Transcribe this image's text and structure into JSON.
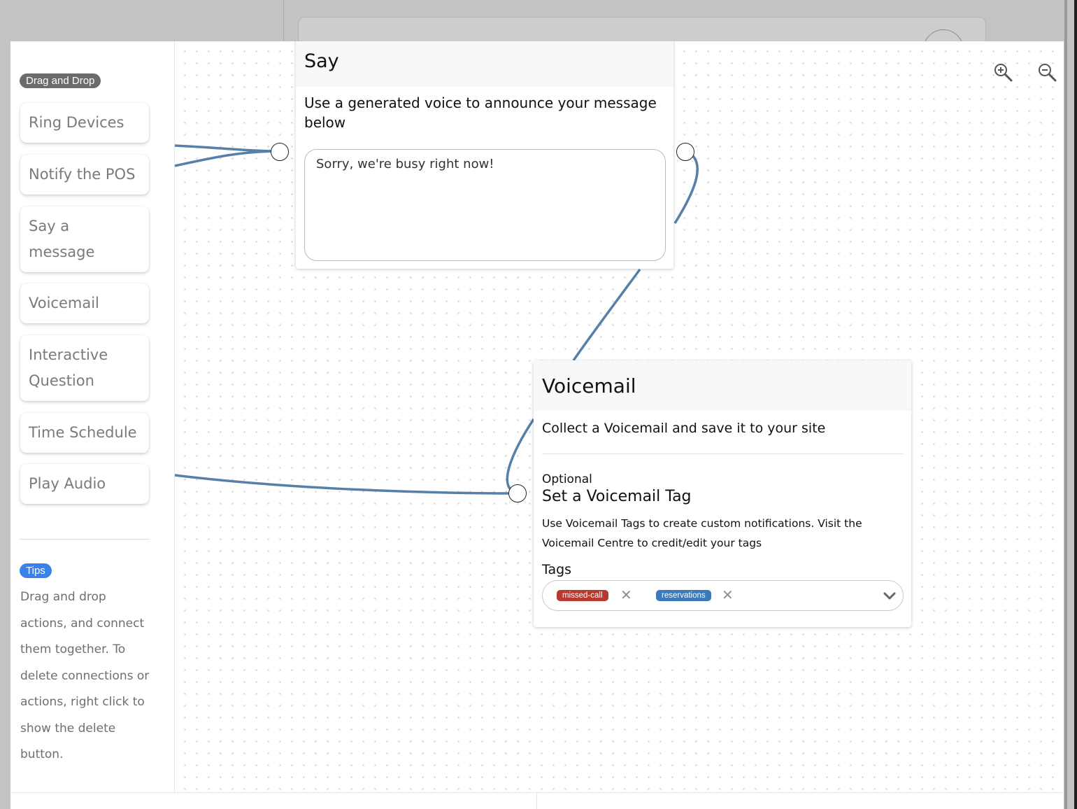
{
  "sidebar": {
    "section_label": "Drag and Drop",
    "tools": [
      {
        "label": "Ring Devices"
      },
      {
        "label": "Notify the POS"
      },
      {
        "label": "Say a message"
      },
      {
        "label": "Voicemail"
      },
      {
        "label": "Interactive Question"
      },
      {
        "label": "Time Schedule"
      },
      {
        "label": "Play Audio"
      }
    ],
    "tips_label": "Tips",
    "tips_text": "Drag and drop actions, and connect them together. To delete connections or actions, right click to show the delete button."
  },
  "canvas": {
    "zoom_in_icon": "zoom-in-icon",
    "zoom_out_icon": "zoom-out-icon",
    "wire_color": "#5780a8"
  },
  "say_node": {
    "title": "Say",
    "description": "Use a generated voice to announce your message below",
    "message": "Sorry, we're busy right now!"
  },
  "voicemail_node": {
    "title": "Voicemail",
    "description": "Collect a Voicemail and save it to your site",
    "optional_label": "Optional",
    "section_title": "Set a Voicemail Tag",
    "help_text": "Use Voicemail Tags to create custom notifications. Visit the Voicemail Centre to credit/edit your tags",
    "tags_label": "Tags",
    "tags": [
      {
        "label": "missed-call",
        "color": "#b83a2e"
      },
      {
        "label": "reservations",
        "color": "#3d7ab8"
      }
    ]
  }
}
